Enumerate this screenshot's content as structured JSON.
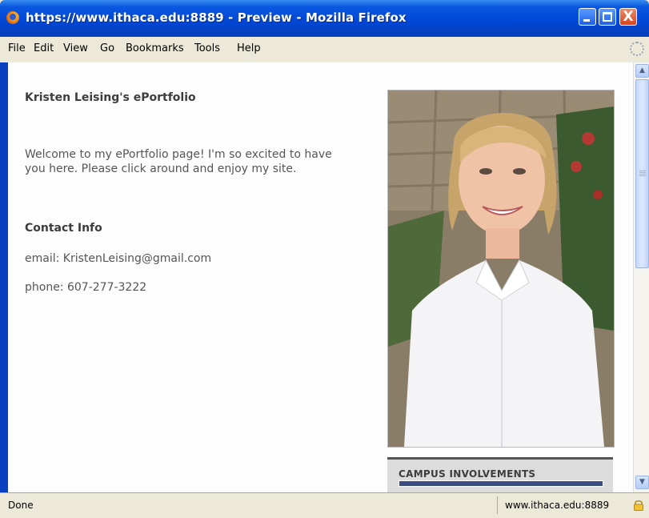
{
  "window": {
    "title": "https://www.ithaca.edu:8889 - Preview - Mozilla Firefox",
    "close_symbol": "X"
  },
  "menu": {
    "items": [
      {
        "label": "File"
      },
      {
        "label": "Edit"
      },
      {
        "label": "View"
      },
      {
        "label": "Go"
      },
      {
        "label": "Bookmarks"
      },
      {
        "label": "Tools"
      },
      {
        "label": "Help"
      }
    ]
  },
  "page": {
    "title": "Kristen Leising's ePortfolio",
    "welcome_line1": "Welcome to my ePortfolio page!  I'm so excited to have",
    "welcome_line2": "you here.  Please click around and enjoy my site.",
    "contact_heading": "Contact Info",
    "email": "email: KristenLeising@gmail.com",
    "phone": "phone: 607-277-3222",
    "sidebar_heading": "CAMPUS INVOLVEMENTS"
  },
  "status": {
    "text": "Done",
    "url": "www.ithaca.edu:8889"
  },
  "colors": {
    "titlebar": "#0046d5",
    "page_background": "#fdfdfd",
    "heading_text": "#3d3d3d",
    "body_text": "#555555",
    "sidebar_box": "#dcdcdc"
  },
  "icons": [
    "firefox-icon",
    "minimize-icon",
    "maximize-icon",
    "close-icon",
    "throbber-icon",
    "scroll-up-icon",
    "scroll-down-icon",
    "lock-icon"
  ]
}
